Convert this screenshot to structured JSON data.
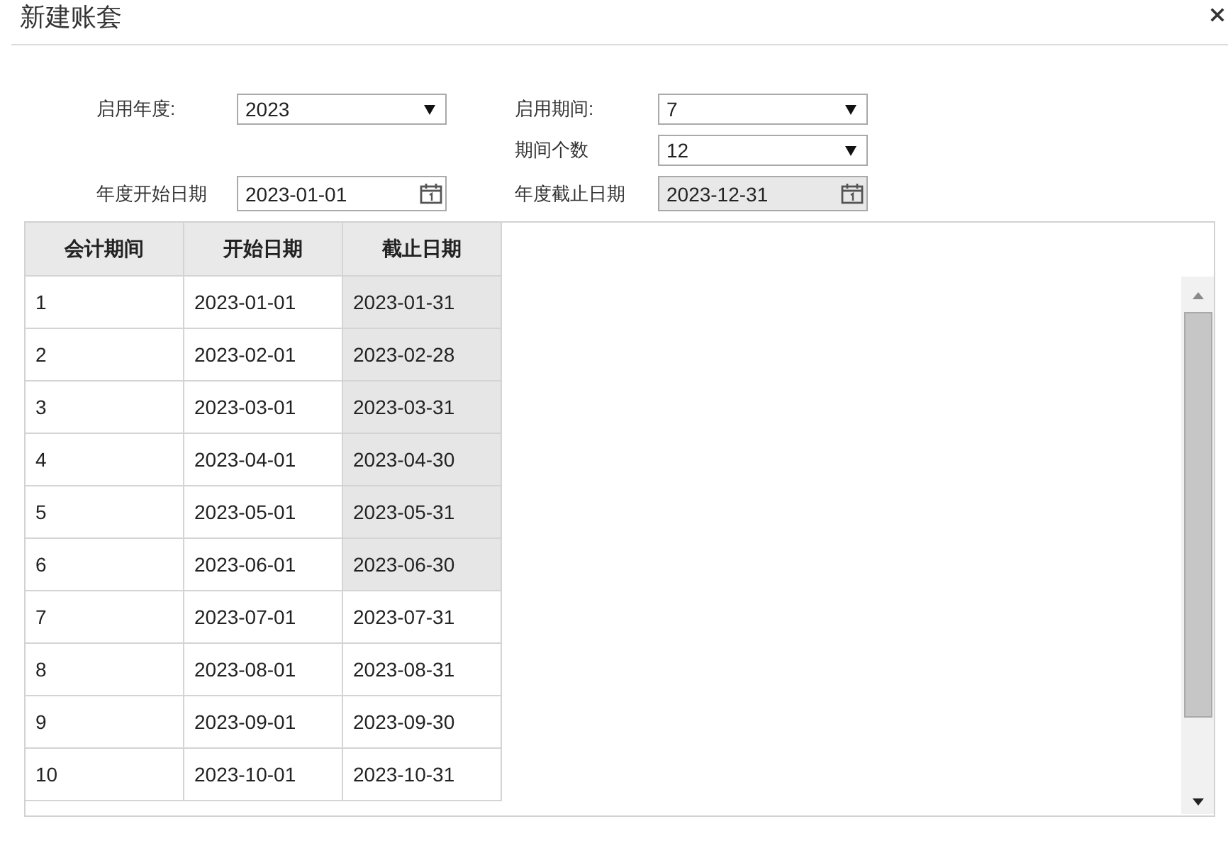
{
  "window": {
    "title": "新建账套"
  },
  "form": {
    "left": [
      {
        "kind": "select",
        "label": "启用年度:",
        "value": "2023",
        "disabled": false
      },
      {
        "kind": "date",
        "label": "年度开始日期",
        "value": "2023-01-01",
        "disabled": false
      }
    ],
    "right": [
      {
        "kind": "select",
        "label": "启用期间:",
        "value": "7",
        "disabled": false
      },
      {
        "kind": "select",
        "label": "期间个数",
        "value": "12",
        "disabled": false
      },
      {
        "kind": "date",
        "label": "年度截止日期",
        "value": "2023-12-31",
        "disabled": true
      }
    ]
  },
  "table": {
    "columns": [
      "会计期间",
      "开始日期",
      "截止日期"
    ],
    "rows": [
      {
        "period": "1",
        "start": "2023-01-01",
        "end": "2023-01-31",
        "end_disabled": true
      },
      {
        "period": "2",
        "start": "2023-02-01",
        "end": "2023-02-28",
        "end_disabled": true
      },
      {
        "period": "3",
        "start": "2023-03-01",
        "end": "2023-03-31",
        "end_disabled": true
      },
      {
        "period": "4",
        "start": "2023-04-01",
        "end": "2023-04-30",
        "end_disabled": true
      },
      {
        "period": "5",
        "start": "2023-05-01",
        "end": "2023-05-31",
        "end_disabled": true
      },
      {
        "period": "6",
        "start": "2023-06-01",
        "end": "2023-06-30",
        "end_disabled": true
      },
      {
        "period": "7",
        "start": "2023-07-01",
        "end": "2023-07-31",
        "end_disabled": false
      },
      {
        "period": "8",
        "start": "2023-08-01",
        "end": "2023-08-31",
        "end_disabled": false
      },
      {
        "period": "9",
        "start": "2023-09-01",
        "end": "2023-09-30",
        "end_disabled": false
      },
      {
        "period": "10",
        "start": "2023-10-01",
        "end": "2023-10-31",
        "end_disabled": false
      }
    ]
  }
}
